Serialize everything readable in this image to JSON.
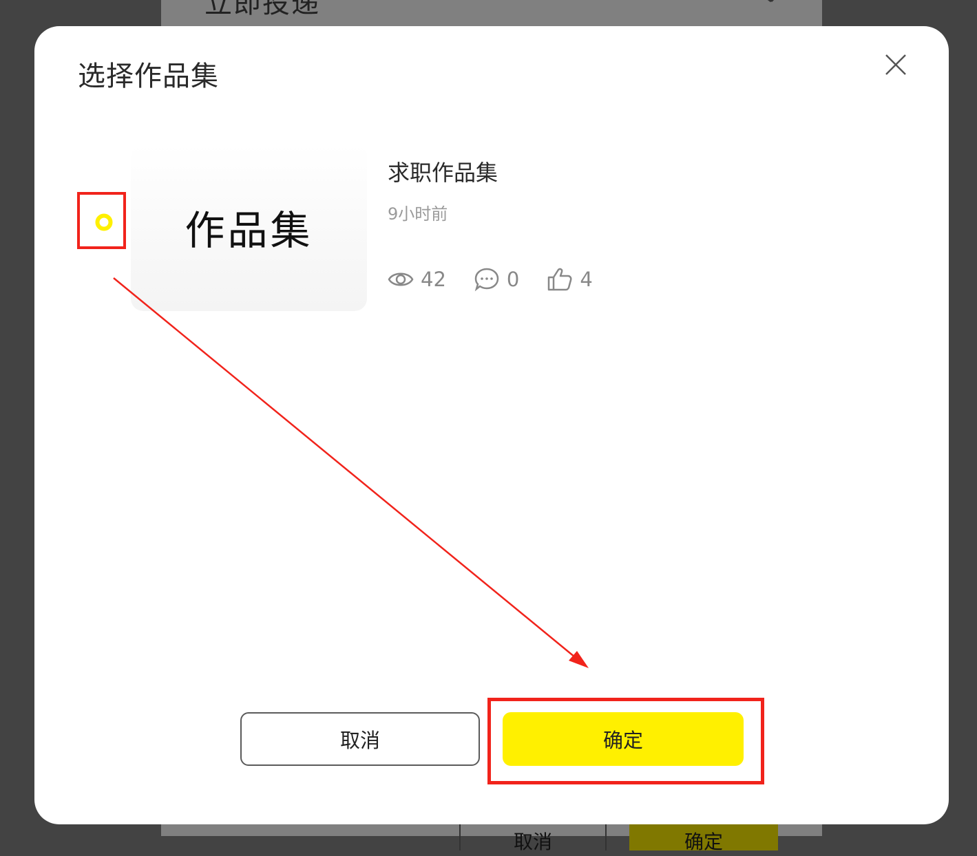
{
  "background": {
    "title": "立即投递",
    "cancel_label": "取消",
    "confirm_label": "确定"
  },
  "modal": {
    "title": "选择作品集",
    "items": [
      {
        "selected": true,
        "thumbnail_text": "作品集",
        "name": "求职作品集",
        "time": "9小时前",
        "views": "42",
        "comments": "0",
        "likes": "4"
      }
    ],
    "cancel_label": "取消",
    "confirm_label": "确定"
  },
  "colors": {
    "accent": "#fff000",
    "annotation": "#f1231b",
    "overlay": "#434343"
  },
  "icons": {
    "close": "close-icon",
    "radio": "radio-selected-icon",
    "views": "eye-icon",
    "comments": "comment-icon",
    "likes": "thumbs-up-icon"
  }
}
